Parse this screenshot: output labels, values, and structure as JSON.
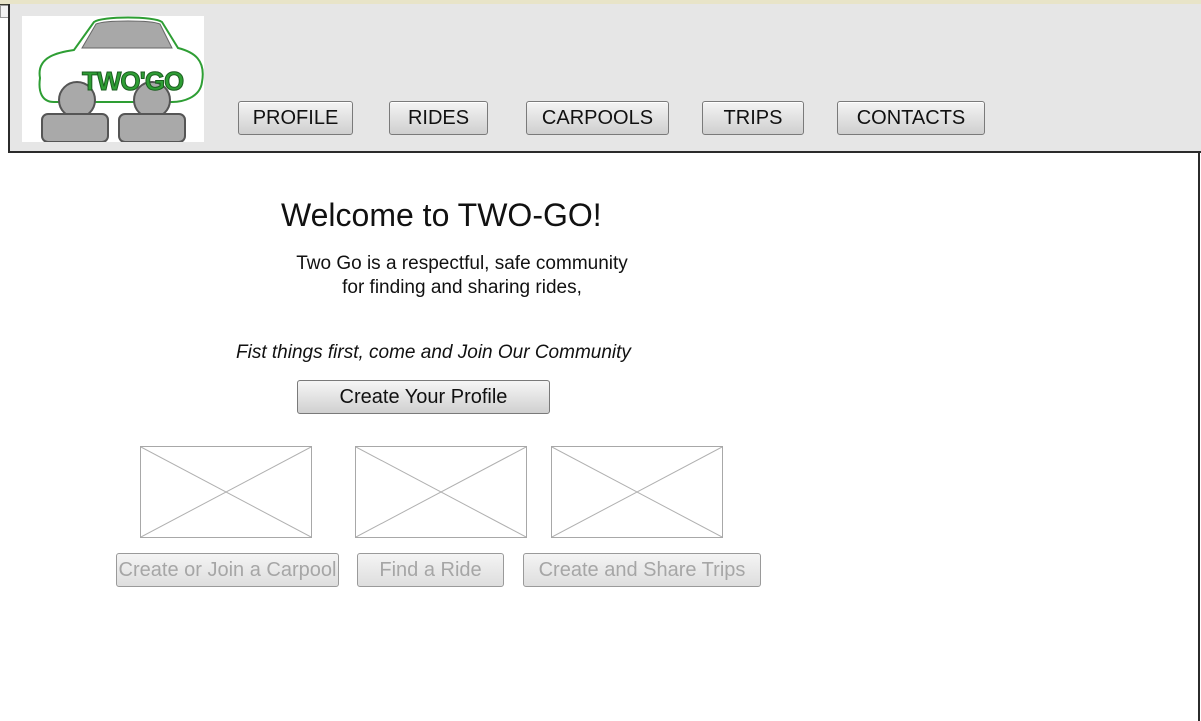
{
  "logo": {
    "text": "TWO'GO"
  },
  "nav": {
    "profile": "PROFILE",
    "rides": "RIDES",
    "carpools": "CARPOOLS",
    "trips": "TRIPS",
    "contacts": "CONTACTS"
  },
  "main": {
    "title": "Welcome to TWO-GO!",
    "desc_line1": "Two Go is a respectful, safe community",
    "desc_line2": "for finding and sharing rides,",
    "tagline": "Fist things first, come and Join Our Community",
    "cta": "Create Your Profile"
  },
  "features": {
    "carpool": "Create or Join a Carpool",
    "ride": "Find a Ride",
    "trips": "Create and Share Trips"
  },
  "colors": {
    "accent": "#2e9e34",
    "header_bg": "#e6e6e6",
    "disabled_text": "#a6a6a6"
  }
}
